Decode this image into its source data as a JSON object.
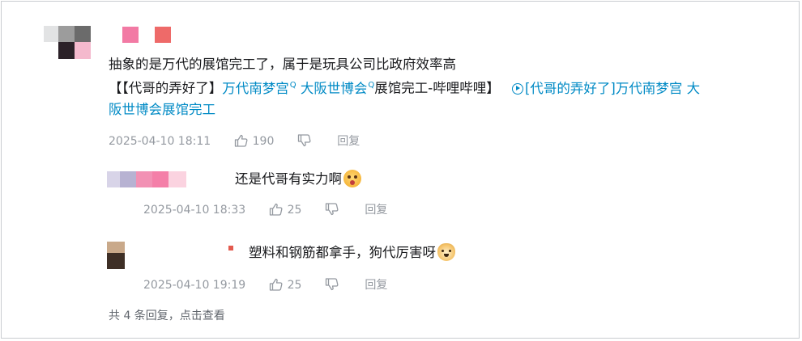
{
  "comment": {
    "text_line1": "抽象的是万代的展馆完工了，属于是玩具公司比政府效率高",
    "text_line2_prefix": "【【代哥的弄好了】",
    "link1": "万代南梦宫",
    "link2": "大阪世博会",
    "text_line2_mid": "展馆完工-哔哩哔哩】",
    "video_link_part1": "[代哥的弄好了]万代南梦宫 大",
    "video_link_part2": "阪世博会展馆完工",
    "time": "2025-04-10 18:11",
    "likes": "190",
    "reply_label": "回复"
  },
  "replies": [
    {
      "text": "还是代哥有实力啊",
      "time": "2025-04-10 18:33",
      "likes": "25",
      "reply_label": "回复",
      "emoji": "wow-face-emoji"
    },
    {
      "text": "塑料和钢筋都拿手，狗代厉害呀",
      "time": "2025-04-10 19:19",
      "likes": "25",
      "reply_label": "回复",
      "emoji": "doge-emoji"
    }
  ],
  "view_more": "共 4 条回复，点击查看",
  "colors": {
    "link": "#008ac5",
    "meta": "#9499a0",
    "text": "#18191c"
  }
}
